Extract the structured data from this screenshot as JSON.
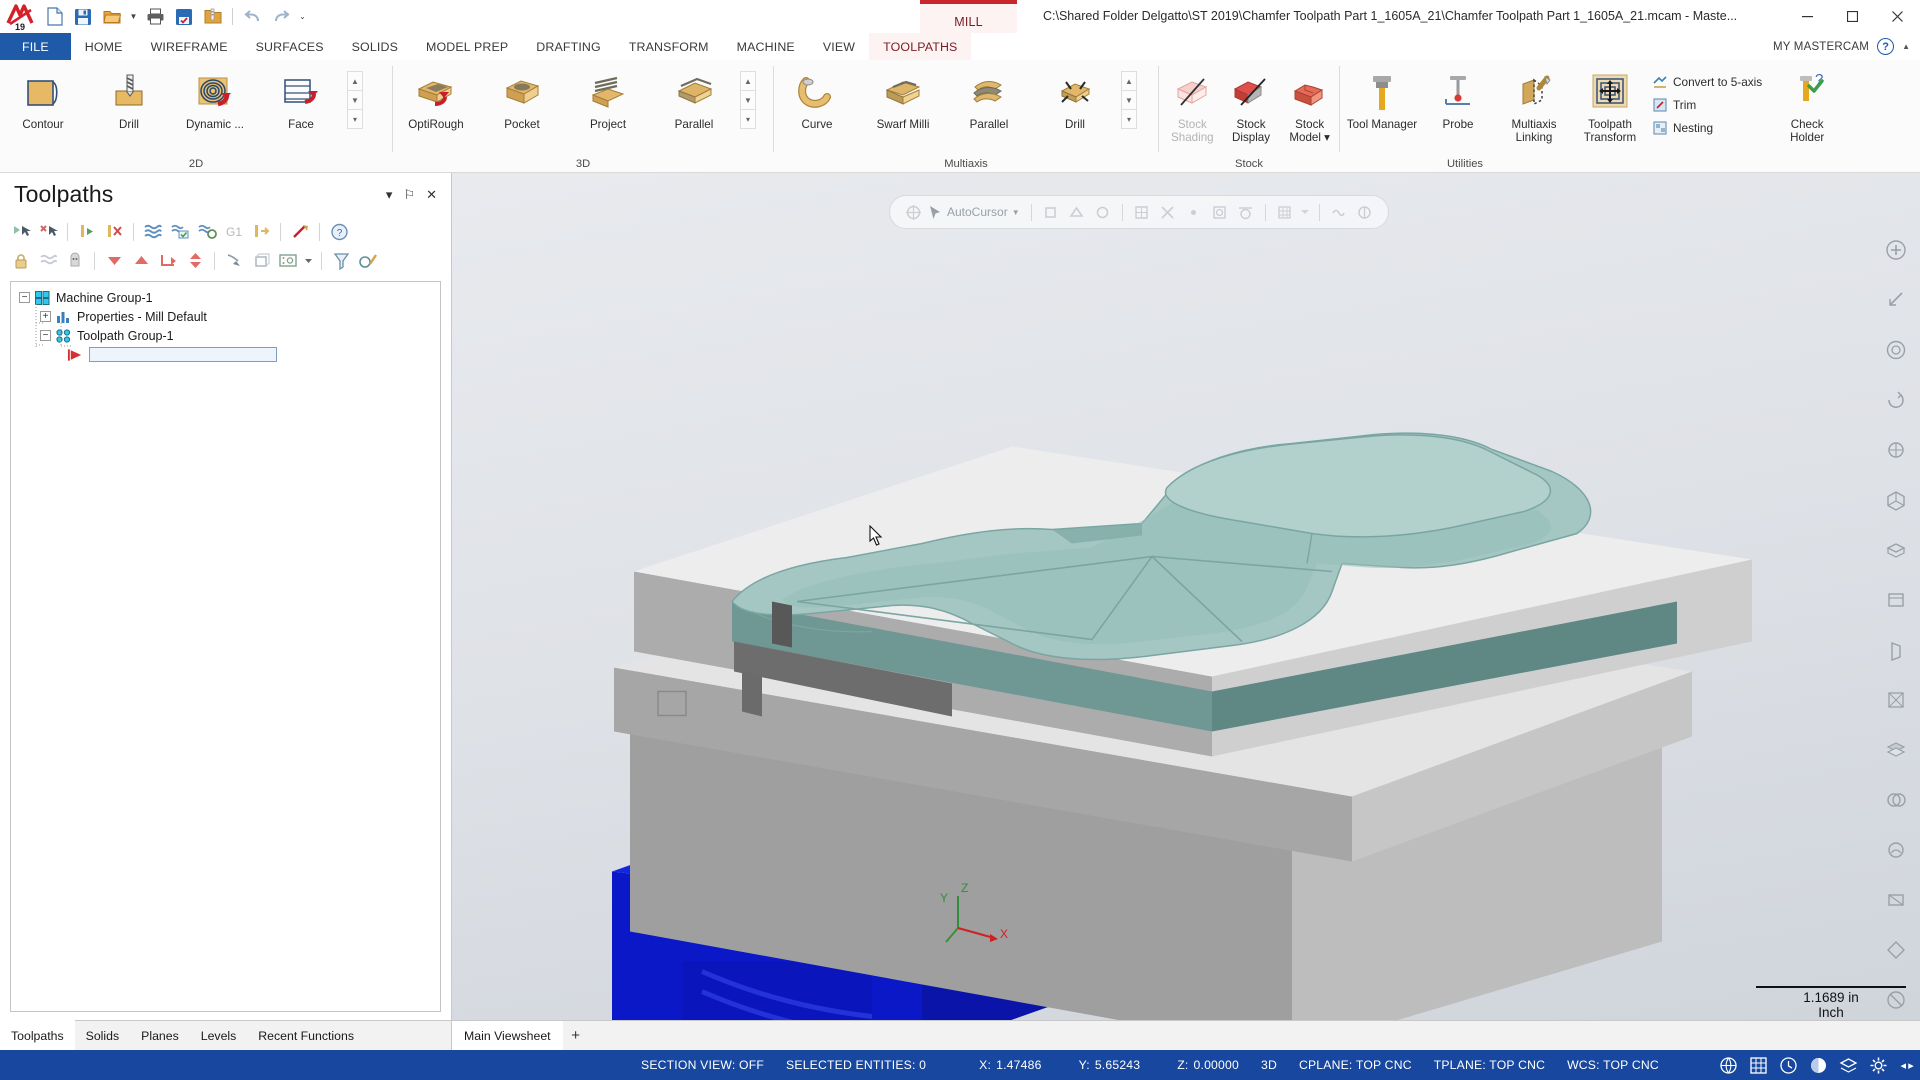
{
  "titlebar": {
    "logo_name": "mastercam-logo",
    "logo_year": "19",
    "quick_access": [
      {
        "name": "new-file-button",
        "icon": "new-document-icon"
      },
      {
        "name": "save-file-button",
        "icon": "floppy-disk-icon"
      },
      {
        "name": "open-file-button",
        "icon": "open-folder-icon"
      },
      {
        "name": "open-dropdown-button",
        "icon": "chevron-down-icon"
      },
      {
        "name": "print-button",
        "icon": "printer-icon"
      },
      {
        "name": "save-as-button",
        "icon": "save-as-icon"
      },
      {
        "name": "zip2go-button",
        "icon": "folder-zip-icon"
      },
      {
        "name": "undo-button",
        "icon": "undo-arrow-icon"
      },
      {
        "name": "redo-button",
        "icon": "redo-arrow-icon"
      },
      {
        "name": "customize-qat-button",
        "icon": "overflow-caret-icon"
      }
    ],
    "mill_tab": "MILL",
    "file_path": "C:\\Shared Folder Delgatto\\ST 2019\\Chamfer Toolpath Part 1_1605A_21\\Chamfer Toolpath Part 1_1605A_21.mcam - Maste...",
    "window_controls": {
      "minimize": "–",
      "maximize": "❐",
      "close": "✕"
    }
  },
  "ribbon": {
    "tabs": [
      {
        "label": "FILE",
        "id": "file"
      },
      {
        "label": "HOME",
        "id": "home"
      },
      {
        "label": "WIREFRAME",
        "id": "wireframe"
      },
      {
        "label": "SURFACES",
        "id": "surfaces"
      },
      {
        "label": "SOLIDS",
        "id": "solids"
      },
      {
        "label": "MODEL PREP",
        "id": "model-prep"
      },
      {
        "label": "DRAFTING",
        "id": "drafting"
      },
      {
        "label": "TRANSFORM",
        "id": "transform"
      },
      {
        "label": "MACHINE",
        "id": "machine"
      },
      {
        "label": "VIEW",
        "id": "view"
      },
      {
        "label": "TOOLPATHS",
        "id": "toolpaths"
      }
    ],
    "active_tab": "TOOLPATHS",
    "my_mastercam": "MY MASTERCAM",
    "help_icon": "help-question-icon",
    "groups": [
      {
        "title": "2D",
        "id": "group-2d",
        "buttons": [
          {
            "label": "Contour",
            "icon": "contour-toolpath-icon"
          },
          {
            "label": "Drill",
            "icon": "drill-toolpath-icon"
          },
          {
            "label": "Dynamic ...",
            "icon": "dynamic-mill-icon"
          },
          {
            "label": "Face",
            "icon": "face-toolpath-icon"
          }
        ],
        "has_scroller": true
      },
      {
        "title": "3D",
        "id": "group-3d",
        "buttons": [
          {
            "label": "OptiRough",
            "icon": "optirough-icon"
          },
          {
            "label": "Pocket",
            "icon": "pocket-3d-icon"
          },
          {
            "label": "Project",
            "icon": "project-3d-icon"
          },
          {
            "label": "Parallel",
            "icon": "parallel-3d-icon"
          }
        ],
        "has_scroller": true
      },
      {
        "title": "Multiaxis",
        "id": "group-multiaxis",
        "buttons": [
          {
            "label": "Curve",
            "icon": "curve-multiaxis-icon"
          },
          {
            "label": "Swarf Milli",
            "icon": "swarf-milling-icon"
          },
          {
            "label": "Parallel",
            "icon": "parallel-multiaxis-icon"
          },
          {
            "label": "Drill",
            "icon": "drill-multiaxis-icon"
          }
        ],
        "has_scroller": true
      },
      {
        "title": "Stock",
        "id": "group-stock",
        "buttons": [
          {
            "label": "Stock Shading",
            "icon": "stock-shading-icon",
            "disabled": true
          },
          {
            "label": "Stock Display",
            "icon": "stock-display-icon"
          },
          {
            "label": "Stock Model ▾",
            "icon": "stock-model-icon"
          }
        ]
      },
      {
        "title": "Utilities",
        "id": "group-utilities",
        "buttons": [
          {
            "label": "Tool Manager",
            "icon": "tool-manager-icon"
          },
          {
            "label": "Probe",
            "icon": "probe-icon"
          },
          {
            "label": "Multiaxis Linking",
            "icon": "multiaxis-linking-icon"
          },
          {
            "label": "Toolpath Transform",
            "icon": "toolpath-transform-icon"
          }
        ],
        "small_buttons": [
          {
            "label": "Convert to 5-axis",
            "icon": "convert-5axis-icon"
          },
          {
            "label": "Trim",
            "icon": "trim-icon"
          },
          {
            "label": "Nesting",
            "icon": "nesting-icon"
          }
        ],
        "tail_button": {
          "label": "Check Holder",
          "icon": "check-holder-icon"
        }
      }
    ]
  },
  "toolpaths_panel": {
    "title": "Toolpaths",
    "header_buttons": [
      {
        "name": "panel-minimize-button",
        "glyph": "▾"
      },
      {
        "name": "panel-pin-button",
        "glyph": "⚐"
      },
      {
        "name": "panel-close-button",
        "glyph": "✕"
      }
    ],
    "toolbar_row1": [
      {
        "name": "select-all-operations-icon"
      },
      {
        "name": "deselect-all-operations-icon"
      },
      {
        "name": "regenerate-selected-icon"
      },
      {
        "name": "regenerate-invalid-icon"
      },
      {
        "name": "backplot-selected-icon"
      },
      {
        "name": "verify-selected-icon"
      },
      {
        "name": "simulate-machine-icon"
      },
      {
        "name": "g1-post-icon",
        "text": "G1"
      },
      {
        "name": "high-speed-toolpath-icon"
      },
      {
        "name": "post-selected-icon"
      },
      {
        "name": "help-operations-icon"
      }
    ],
    "toolbar_row2": [
      {
        "name": "lock-selected-icon"
      },
      {
        "name": "toggle-posting-icon"
      },
      {
        "name": "toggle-toolpath-display-icon"
      },
      {
        "name": "move-down-icon"
      },
      {
        "name": "move-up-icon"
      },
      {
        "name": "move-insert-arrow-icon"
      },
      {
        "name": "expand-collapse-icon"
      },
      {
        "name": "only-selected-icon"
      },
      {
        "name": "single-display-icon"
      },
      {
        "name": "machine-group-options-icon"
      },
      {
        "name": "options-dropdown-icon"
      },
      {
        "name": "toolpath-manager-icon"
      },
      {
        "name": "advanced-display-icon"
      }
    ],
    "tree": [
      {
        "label": "Machine Group-1",
        "icon": "machine-group-icon",
        "depth": 0,
        "expander": "−"
      },
      {
        "label": "Properties - Mill Default",
        "icon": "properties-icon",
        "depth": 1,
        "expander": "+"
      },
      {
        "label": "Toolpath Group-1",
        "icon": "toolpath-group-icon",
        "depth": 1,
        "expander": "−"
      },
      {
        "label": "",
        "icon": "insert-arrow-icon",
        "depth": 2,
        "expander": "",
        "editing": true
      }
    ],
    "bottom_tabs": [
      {
        "label": "Toolpaths",
        "active": true
      },
      {
        "label": "Solids",
        "active": false
      },
      {
        "label": "Planes",
        "active": false
      },
      {
        "label": "Levels",
        "active": false
      },
      {
        "label": "Recent Functions",
        "active": false
      }
    ]
  },
  "viewport": {
    "autocursor_label": "AutoCursor",
    "autocursor_icons": [
      "autocursor-target-icon",
      "autocursor-dropdown-icon",
      "snap-endpoint-icon",
      "snap-midpoint-icon",
      "snap-center-icon",
      "snap-quadrant-icon",
      "snap-intersection-icon",
      "snap-point-icon",
      "snap-nearest-icon",
      "snap-tangent-icon",
      "snap-perpendicular-icon",
      "snap-grid-icon",
      "snap-grid-dropdown-icon",
      "snap-relative-icon",
      "snap-along-icon"
    ],
    "right_toolbar": [
      {
        "name": "fit-screen-icon"
      },
      {
        "name": "zoom-window-icon"
      },
      {
        "name": "unzoom-icon"
      },
      {
        "name": "dynamic-rotate-icon"
      },
      {
        "name": "pan-icon"
      },
      {
        "name": "isometric-view-icon"
      },
      {
        "name": "top-view-icon"
      },
      {
        "name": "front-view-icon"
      },
      {
        "name": "right-view-icon"
      },
      {
        "name": "wireframe-shade-icon"
      },
      {
        "name": "shaded-view-icon"
      },
      {
        "name": "translucency-icon"
      },
      {
        "name": "material-icon"
      },
      {
        "name": "blank-entity-icon"
      },
      {
        "name": "unblank-entity-icon"
      },
      {
        "name": "clear-colors-icon"
      }
    ],
    "axis": {
      "x": "X",
      "y": "Y",
      "z": "Z"
    },
    "scale_value": "1.1689 in",
    "scale_unit": "Inch",
    "viewsheet_tabs": [
      {
        "label": "Main Viewsheet",
        "active": true
      }
    ],
    "viewsheet_add": "+"
  },
  "statusbar": {
    "section_view": "SECTION VIEW: OFF",
    "selected_entities": "SELECTED ENTITIES: 0",
    "coord_x_label": "X:",
    "coord_x": "1.47486",
    "coord_y_label": "Y:",
    "coord_y": "5.65243",
    "coord_z_label": "Z:",
    "coord_z": "0.00000",
    "mode": "3D",
    "cplane": "CPLANE: TOP CNC",
    "tplane": "TPLANE: TOP CNC",
    "wcs": "WCS: TOP CNC",
    "icons": [
      {
        "name": "globe-wcs-icon"
      },
      {
        "name": "planes-grid-icon"
      },
      {
        "name": "clock-history-icon"
      },
      {
        "name": "sphere-shading-icon"
      },
      {
        "name": "level-display-icon"
      },
      {
        "name": "config-gear-icon"
      }
    ],
    "nav_arrows": [
      "◂",
      "▸"
    ]
  },
  "colors": {
    "accent_blue": "#17479e",
    "file_tab_blue": "#1e5aa8",
    "mill_red": "#c9252c",
    "part_teal": "#8fb5b2",
    "stock_gray": "#d8d8d8",
    "vise_blue": "#0b18c8"
  }
}
